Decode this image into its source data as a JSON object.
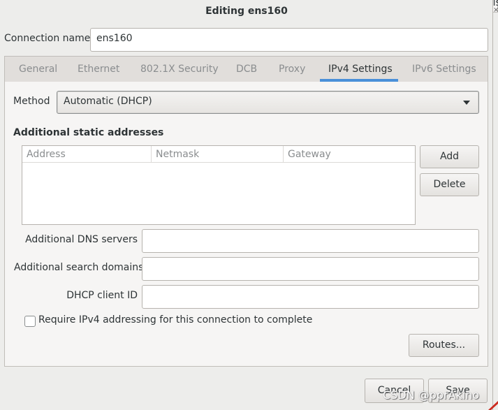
{
  "background_window": {
    "title_fragment": "Regis",
    "close_glyph": "×"
  },
  "dialog": {
    "title": "Editing ens160"
  },
  "connection": {
    "label": "Connection name",
    "value": "ens160"
  },
  "tabs": [
    {
      "label": "General",
      "active": false
    },
    {
      "label": "Ethernet",
      "active": false
    },
    {
      "label": "802.1X Security",
      "active": false
    },
    {
      "label": "DCB",
      "active": false
    },
    {
      "label": "Proxy",
      "active": false
    },
    {
      "label": "IPv4 Settings",
      "active": true
    },
    {
      "label": "IPv6 Settings",
      "active": false
    }
  ],
  "ipv4": {
    "method_label": "Method",
    "method_value": "Automatic (DHCP)",
    "static_title": "Additional static addresses",
    "columns": [
      "Address",
      "Netmask",
      "Gateway"
    ],
    "rows": [],
    "add_label": "Add",
    "delete_label": "Delete",
    "dns_label": "Additional DNS servers",
    "dns_value": "",
    "search_label": "Additional search domains",
    "search_value": "",
    "dhcp_label": "DHCP client ID",
    "dhcp_value": "",
    "require_label": "Require IPv4 addressing for this connection to complete",
    "require_checked": false,
    "routes_label": "Routes..."
  },
  "footer": {
    "cancel_label": "Cancel",
    "save_label": "Save"
  },
  "watermark": "CSDN @pprAkino",
  "colors": {
    "accent": "#4a90d9",
    "window_bg": "#ededeb",
    "page_bg": "#f6f5f4",
    "inactive_tab_text": "#8a8d8f"
  }
}
